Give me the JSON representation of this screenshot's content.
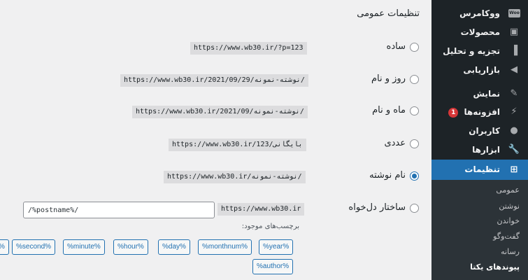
{
  "settings": {
    "section_title": "تنظیمات عمومی",
    "options": [
      {
        "label": "ساده",
        "example": "https://www.wb30.ir/?p=123",
        "checked": false
      },
      {
        "label": "روز و نام",
        "example": "https://www.wb30.ir/2021/09/29/نوشته-نمونه/",
        "checked": false
      },
      {
        "label": "ماه و نام",
        "example": "https://www.wb30.ir/2021/09/نوشته-نمونه/",
        "checked": false
      },
      {
        "label": "عددی",
        "example": "https://www.wb30.ir/بایگانی/123",
        "checked": false
      },
      {
        "label": "نام نوشته",
        "example": "https://www.wb30.ir/نوشته-نمونه/",
        "checked": true
      },
      {
        "label": "ساختار دل‌خواه",
        "example": "https://www.wb30.ir",
        "checked": false
      }
    ],
    "custom_value": "/%postname%/",
    "available_tags_label": "برچسب‌های موجود:",
    "tags_row1": [
      "%year%",
      "%monthnum%",
      "%day%",
      "%hour%",
      "%minute%",
      "%second%",
      "%"
    ],
    "tags_row2": [
      "%author%"
    ]
  },
  "sidebar": {
    "items": [
      {
        "label": "ووکامرس",
        "icon": "woocommerce-icon"
      },
      {
        "label": "محصولات",
        "icon": "archive-icon"
      },
      {
        "label": "تجزیه و تحلیل",
        "icon": "chart-bar-icon"
      },
      {
        "label": "بازاریابی",
        "icon": "megaphone-icon"
      },
      {
        "label": "نمایش",
        "icon": "brush-icon"
      },
      {
        "label": "افزونه‌ها",
        "icon": "plugin-icon",
        "badge": "1"
      },
      {
        "label": "کاربران",
        "icon": "users-icon"
      },
      {
        "label": "ابزارها",
        "icon": "wrench-icon"
      },
      {
        "label": "تنظیمات",
        "icon": "settings-icon",
        "active": true
      }
    ],
    "submenu": [
      "عمومی",
      "نوشتن",
      "خواندن",
      "گفت‌وگو",
      "رسانه",
      "پیوندهای یکتا"
    ]
  },
  "colors": {
    "admin_bar": "#1d2327",
    "active": "#2271b1",
    "badge": "#d63638"
  }
}
